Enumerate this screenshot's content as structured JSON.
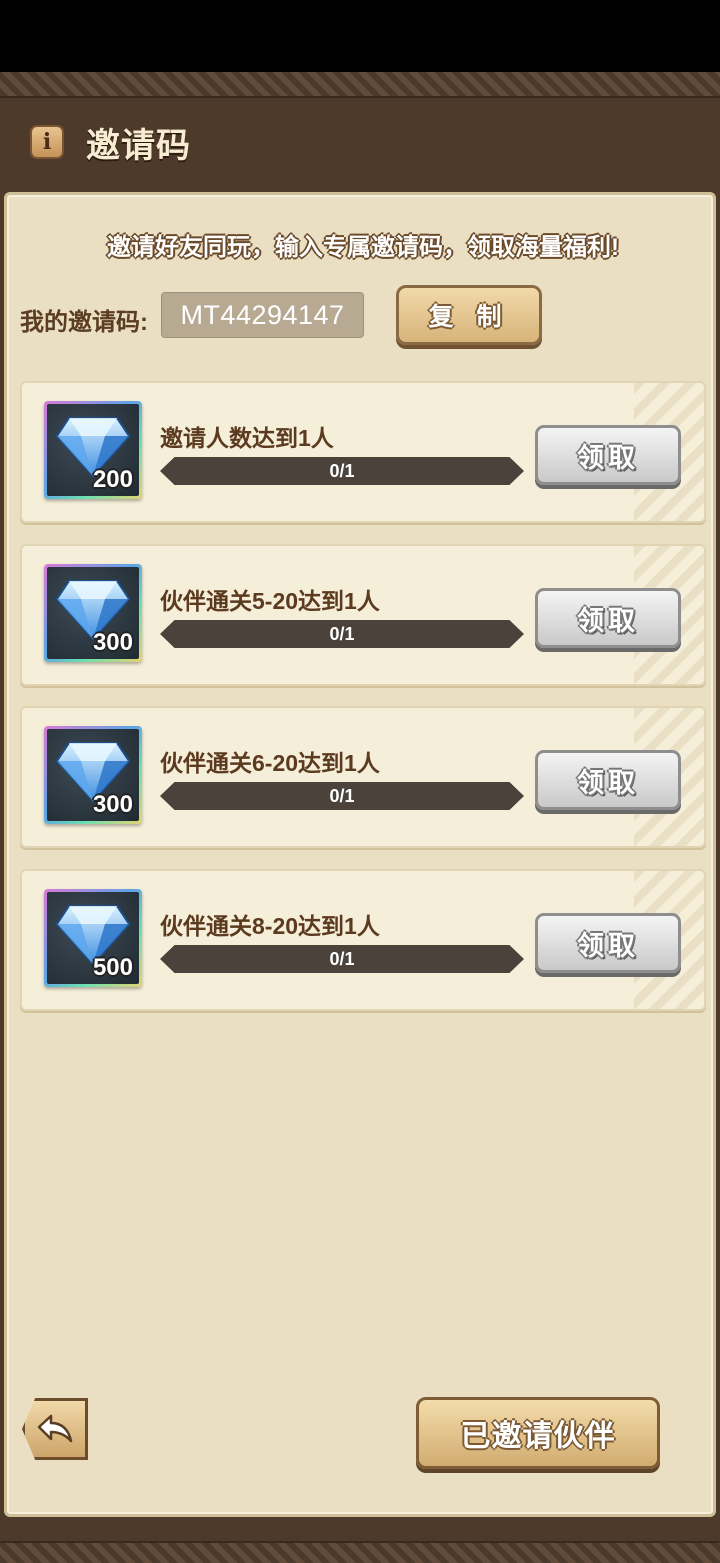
{
  "header": {
    "title": "邀请码",
    "info_icon": "info-icon"
  },
  "intro_text": "邀请好友同玩，输入专属邀请码，领取海量福利!",
  "invite_code": {
    "label": "我的邀请码:",
    "value": "MT44294147",
    "copy_label": "复 制"
  },
  "tasks": [
    {
      "title": "邀请人数达到1人",
      "reward_count": "200",
      "progress_text": "0/1",
      "progress": 0,
      "claim_label": "领取"
    },
    {
      "title": "伙伴通关5-20达到1人",
      "reward_count": "300",
      "progress_text": "0/1",
      "progress": 0,
      "claim_label": "领取"
    },
    {
      "title": "伙伴通关6-20达到1人",
      "reward_count": "300",
      "progress_text": "0/1",
      "progress": 0,
      "claim_label": "领取"
    },
    {
      "title": "伙伴通关8-20达到1人",
      "reward_count": "500",
      "progress_text": "0/1",
      "progress": 0,
      "claim_label": "领取"
    }
  ],
  "footer": {
    "back_icon": "back-arrow-icon",
    "invited_label": "已邀请伙伴"
  },
  "colors": {
    "panel": "#eadfc2",
    "frame": "#4e3a2a",
    "button_gold": "#d7b47a",
    "button_gray": "#c9c9c9"
  }
}
